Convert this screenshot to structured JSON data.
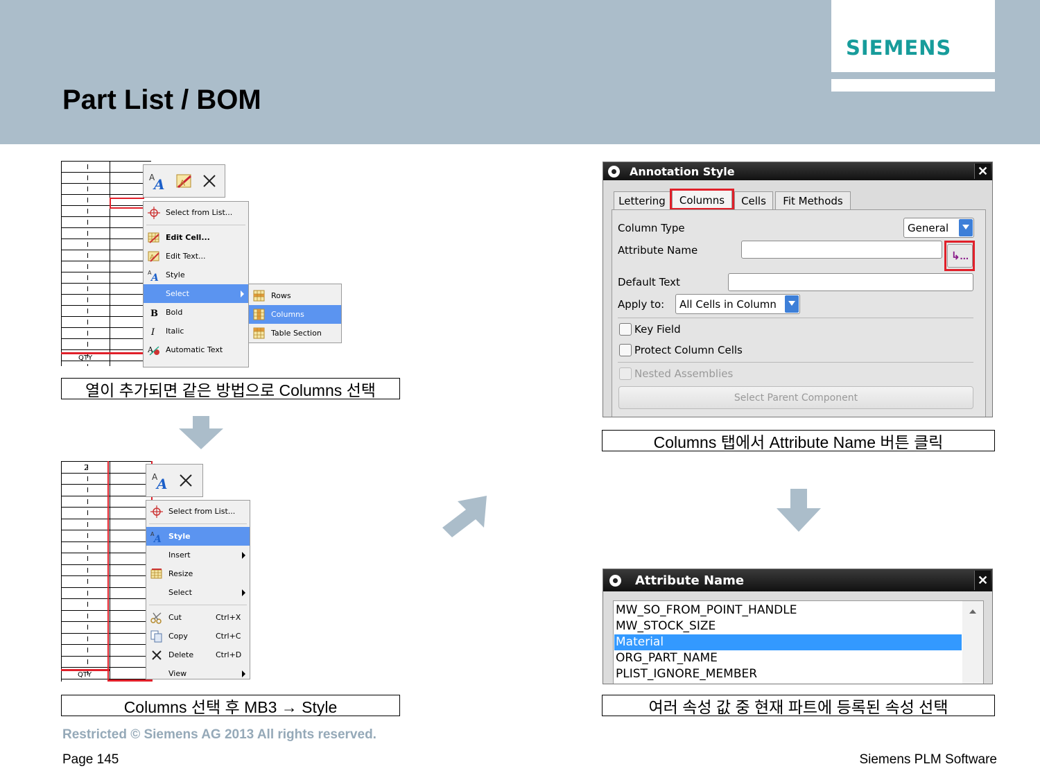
{
  "header": {
    "title": "Part List / BOM",
    "logo": "SIEMENS"
  },
  "step1": {
    "toolbar_icons": [
      "style-icon",
      "edit-text-icon",
      "close-icon"
    ],
    "menu": [
      {
        "label": "Select from List...",
        "icon": "crosshair-icon"
      },
      {
        "label": "Edit Cell...",
        "icon": "edit-cell-icon",
        "bold": true
      },
      {
        "label": "Edit Text...",
        "icon": "edit-text-icon"
      },
      {
        "label": "Style",
        "icon": "style-icon"
      },
      {
        "label": "Select",
        "icon": "",
        "submenu": true,
        "highlight": true
      },
      {
        "label": "Bold",
        "icon": "bold-icon"
      },
      {
        "label": "Italic",
        "icon": "italic-icon"
      },
      {
        "label": "Automatic Text",
        "icon": "automatic-text-icon"
      }
    ],
    "submenu": [
      {
        "label": "Rows",
        "icon": "rows-icon"
      },
      {
        "label": "Columns",
        "icon": "columns-icon",
        "highlight": true
      },
      {
        "label": "Table Section",
        "icon": "table-section-icon"
      }
    ],
    "qty": "QTY",
    "caption": "열이 추가되면 같은 방법으로 Columns 선택"
  },
  "step2": {
    "toolbar_icons": [
      "style-icon",
      "close-icon"
    ],
    "menu": [
      {
        "label": "Select from List...",
        "icon": "crosshair-icon"
      },
      {
        "label": "Style",
        "icon": "style-icon",
        "highlight": true,
        "bold": true
      },
      {
        "label": "Insert",
        "icon": "",
        "submenu": true
      },
      {
        "label": "Resize",
        "icon": "resize-icon"
      },
      {
        "label": "Select",
        "icon": "",
        "submenu": true
      },
      {
        "label": "Cut",
        "icon": "cut-icon",
        "shortcut": "Ctrl+X"
      },
      {
        "label": "Copy",
        "icon": "copy-icon",
        "shortcut": "Ctrl+C"
      },
      {
        "label": "Delete",
        "icon": "delete-icon",
        "shortcut": "Ctrl+D"
      },
      {
        "label": "View",
        "icon": "",
        "submenu": true
      }
    ],
    "top_cell": "2",
    "qty": "QTY",
    "caption": "Columns 선택 후 MB3 → Style"
  },
  "annotation_dialog": {
    "title": "Annotation Style",
    "tabs": [
      "Lettering",
      "Columns",
      "Cells",
      "Fit Methods"
    ],
    "active_tab": "Columns",
    "column_type_label": "Column Type",
    "column_type_value": "General",
    "attribute_name_label": "Attribute Name",
    "attribute_name_value": "",
    "attribute_button": "↳...",
    "default_text_label": "Default Text",
    "default_text_value": "",
    "apply_to_label": "Apply to:",
    "apply_to_value": "All Cells in Column",
    "key_field": "Key Field",
    "protect_cells": "Protect Column Cells",
    "nested": "Nested Assemblies",
    "select_parent": "Select Parent Component",
    "caption": "Columns 탭에서 Attribute Name 버튼 클릭"
  },
  "attribute_dialog": {
    "title": "Attribute Name",
    "items": [
      "MW_SO_FROM_POINT_HANDLE",
      "MW_STOCK_SIZE",
      "Material",
      "ORG_PART_NAME",
      "PLIST_IGNORE_MEMBER"
    ],
    "selected": "Material",
    "caption": "여러 속성 값 중 현재 파트에 등록된 속성 선택"
  },
  "footer": {
    "restricted": "Restricted © Siemens AG 2013 All rights reserved.",
    "page": "Page 145",
    "company": "Siemens PLM Software"
  },
  "colors": {
    "header_bg": "#abbdca",
    "logo": "#179c9b",
    "highlight": "#5b94f0",
    "red": "#e0202a",
    "arrow": "#abbdca"
  }
}
